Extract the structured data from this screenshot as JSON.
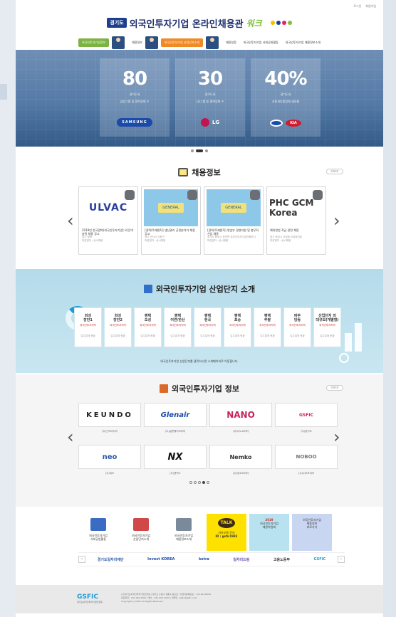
{
  "topbar": {
    "links": [
      "로그인",
      "회원가입"
    ]
  },
  "header": {
    "badge": "경기도",
    "title": "외국인투자기업 온라인채용관",
    "accent": "워크",
    "dot_colors": [
      "#f2c100",
      "#1e3f8f",
      "#e2246b",
      "#7fbf3a"
    ]
  },
  "nav": {
    "items": [
      {
        "label": "외국인투자기업정보",
        "style": "green"
      },
      {
        "label": "채용정보",
        "style": "plain"
      },
      {
        "label": "외국인투자기업 산업단지소개",
        "style": "orange"
      },
      {
        "label": "채용일정",
        "style": "plain"
      },
      {
        "label": "외국인투자기업 사회공헌활동",
        "style": "plain"
      },
      {
        "label": "외국인투자기업 채용정보소개",
        "style": "plain"
      }
    ]
  },
  "hero": {
    "stats": [
      {
        "num": "80",
        "desc1": "경기도내",
        "desc2": "삼성그룹 및 협력업체 수",
        "brand": "SAMSUNG"
      },
      {
        "num": "30",
        "desc1": "경기도내",
        "desc2": "LG그룹 및 협력업체 수",
        "brand": "LG"
      },
      {
        "num": "40%",
        "desc1": "경기도내",
        "desc2": "자동차부품업체 생산율",
        "brand": "KIA"
      }
    ],
    "dots": 3,
    "active_dot": 1
  },
  "jobs": {
    "title": "채용정보",
    "more": "더보기",
    "cards": [
      {
        "logo": "ULVAC",
        "caption": "2019년 한국알박(외국인투자기업) 오전/기술직 채용 공고",
        "sub1": "경기 평택",
        "sub2": "마감일자 : 상시채용"
      },
      {
        "logo": "GENERAL",
        "caption": "[경력/주재원직] 생산관리 공정분석가 채용공고",
        "sub1": "경기 안산시 단원구",
        "sub2": "마감일자 : 상시채용"
      },
      {
        "logo": "GENERAL",
        "caption": "[경력/주재원직] 영업부 경영지원 및 총무직 신입 채용",
        "sub1": "경기도 화성시 장안면 외국인투자기업전용단지",
        "sub2": "마감일자 : 상시채용"
      },
      {
        "logo": "PHC GCM Korea",
        "caption": "해외영업 직급 관련 채용",
        "sub1": "경기 화성시 우정읍 우정공단로",
        "sub2": "마감일자 : 상시채용"
      }
    ]
  },
  "industrial": {
    "title": "외국인투자기업 산업단지 소개",
    "parks": [
      {
        "name1": "화성",
        "name2": "장안1",
        "area": "외국인투자지역",
        "info": "입주업체 현황"
      },
      {
        "name1": "화성",
        "name2": "장안2",
        "area": "외국인투자지역",
        "info": "입주업체 현황"
      },
      {
        "name1": "평택",
        "name2": "오성",
        "area": "외국인투자지역",
        "info": "입주업체 현황"
      },
      {
        "name1": "평택",
        "name2": "어연/한산",
        "area": "외국인투자지역",
        "info": "입주업체 현황"
      },
      {
        "name1": "평택",
        "name2": "현곡",
        "area": "외국인투자지역",
        "info": "입주업체 현황"
      },
      {
        "name1": "평택",
        "name2": "포승",
        "area": "외국인투자지역",
        "info": "입주업체 현황"
      },
      {
        "name1": "평택",
        "name2": "추팔",
        "area": "외국인투자지역",
        "info": "입주업체 현황"
      },
      {
        "name1": "파주",
        "name2": "당동",
        "area": "외국인투자지역",
        "info": "입주업체 현황"
      },
      {
        "name1": "산업단지 외",
        "name2": "대규모(개별형)",
        "area": "외국인투자지역",
        "info": "입주업체 현황"
      }
    ],
    "note": "외국인투자기업 산업단지를 클릭하시면 소개페이지로 이동합니다."
  },
  "companies": {
    "title": "외국인투자기업 정보",
    "more": "더보기",
    "items": [
      {
        "logo": "KEUNDO",
        "name": "(주)근도미디어"
      },
      {
        "logo": "Glenair",
        "name": "(주)글렌에어코리아"
      },
      {
        "logo": "NANO",
        "name": "(주)나노코리아"
      },
      {
        "logo": "GSFIC",
        "name": "(주)경기도"
      },
      {
        "logo": "neo",
        "name": "(주)네오"
      },
      {
        "logo": "NX",
        "name": "(주)엔엑스"
      },
      {
        "logo": "Nemko",
        "name": "(주)넴코코리아"
      },
      {
        "logo": "NOBOO",
        "name": "(주)노부코리아"
      }
    ],
    "dots": 5,
    "active_dot": 3
  },
  "quick": [
    {
      "label1": "외국인투자기업",
      "label2": "사회공헌활동",
      "color": "#3b6cc4"
    },
    {
      "label1": "외국인투자기업",
      "label2": "산업단지소개",
      "color": "#d04848"
    },
    {
      "label1": "외국인투자기업",
      "label2": "채용정보소개",
      "color": "#7a8a9a"
    },
    {
      "label1": "TALK",
      "label2": "카카오톡 문의",
      "label3": "ID : gsfic1983",
      "color": "#ffe100"
    },
    {
      "label1": "2019",
      "label2": "외국인투자기업",
      "label3": "채용박람회",
      "color": "#b8e2f0"
    },
    {
      "label1": "외국인투자기업",
      "label2": "채용정보",
      "label3": "바로가기",
      "color": "#c9d6f2"
    }
  ],
  "partners": [
    "경기도일자리재단",
    "Invest KOREA",
    "kotra",
    "일자리드림",
    "고용노동부",
    "GSFIC"
  ],
  "footer": {
    "logo": "GSFIC",
    "logo_sub": "경기도외국인투자기업인협회",
    "text1": "(사)경기도외국인투자기업인협회 | 경기도 수원시 영통구 광교로 | 사업자등록번호 : 124-82-00000",
    "text2": "대표전화 : 031-000-0000 | 팩스 : 031-000-0000 | 이메일 : gsfic@gsfic.or.kr",
    "copyright": "Copyright(c) GSFIC All Rights Reserved."
  }
}
